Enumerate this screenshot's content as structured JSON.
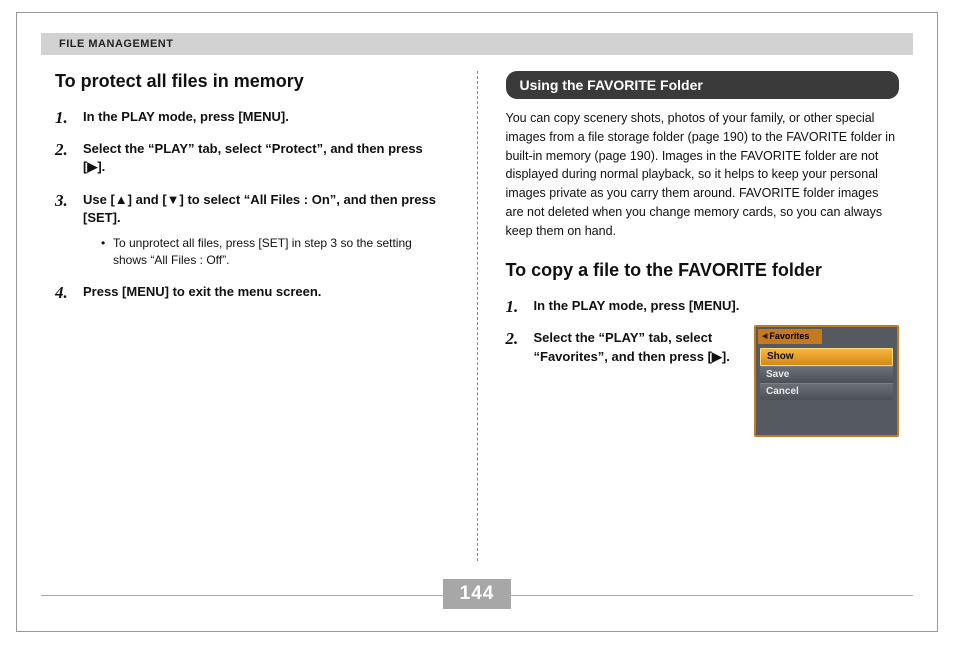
{
  "header": "FILE MANAGEMENT",
  "page_number": "144",
  "left": {
    "heading": "To protect all files in memory",
    "steps": [
      {
        "text": "In the PLAY mode, press [MENU]."
      },
      {
        "text": "Select the “PLAY” tab, select “Protect”, and then press [▶]."
      },
      {
        "text": "Use [▲] and [▼] to select “All Files : On”, and then press [SET].",
        "bullets": [
          "To unprotect all files, press [SET] in step 3 so the setting shows “All Files : Off”."
        ]
      },
      {
        "text": "Press [MENU] to exit the menu screen."
      }
    ]
  },
  "right": {
    "pill": "Using the FAVORITE Folder",
    "body": "You can copy scenery shots, photos of your family, or other special images from a file storage folder (page 190) to the FAVORITE folder in built-in memory (page 190). Images in the FAVORITE folder are not displayed during normal playback, so it helps to keep your personal images private as you carry them around. FAVORITE folder images are not deleted when you change memory cards, so you can always keep them on hand.",
    "heading": "To copy a file to the FAVORITE folder",
    "steps": [
      {
        "text": "In the PLAY mode, press [MENU]."
      },
      {
        "text": "Select the “PLAY” tab, select “Favorites”, and then press [▶]."
      }
    ],
    "menu": {
      "title": "Favorites",
      "items": [
        {
          "label": "Show",
          "selected": true
        },
        {
          "label": "Save",
          "selected": false
        },
        {
          "label": "Cancel",
          "selected": false
        }
      ]
    }
  }
}
